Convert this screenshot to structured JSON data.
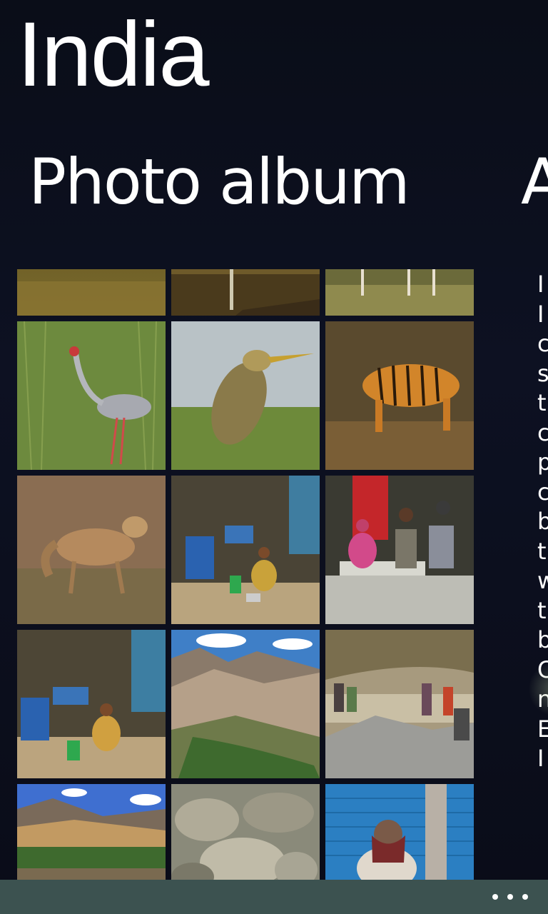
{
  "app": {
    "title": "India"
  },
  "pivot": {
    "current": "Photo album",
    "next_peek": "A"
  },
  "photo_grid": {
    "tiles": [
      {
        "name": "photo-pond",
        "desc": "pond water"
      },
      {
        "name": "photo-heron-legs",
        "desc": "bird legs on log"
      },
      {
        "name": "photo-deer-legs",
        "desc": "deer legs in grass"
      },
      {
        "name": "photo-sarus-crane",
        "desc": "sarus crane"
      },
      {
        "name": "photo-pond-heron",
        "desc": "pond heron"
      },
      {
        "name": "photo-tiger",
        "desc": "tiger"
      },
      {
        "name": "photo-jackal",
        "desc": "jackal"
      },
      {
        "name": "photo-street-family",
        "desc": "family in doorway"
      },
      {
        "name": "photo-people-steps",
        "desc": "people on steps"
      },
      {
        "name": "photo-street-family-2",
        "desc": "family near blue shutter"
      },
      {
        "name": "photo-mountains",
        "desc": "mountain valley"
      },
      {
        "name": "photo-workers-gravel",
        "desc": "workers at gravel pile"
      },
      {
        "name": "photo-valley-town",
        "desc": "valley town"
      },
      {
        "name": "photo-rocks",
        "desc": "rocky ground"
      },
      {
        "name": "photo-man-shutter",
        "desc": "man before blue shutter"
      }
    ]
  },
  "side_panel": {
    "letters": [
      "I",
      "I",
      "c",
      "s",
      "t",
      "c",
      "p",
      "c",
      "b",
      "t",
      "w",
      "t",
      "b",
      "C",
      "n",
      "E",
      "I"
    ]
  },
  "app_bar": {
    "more_label": "more options"
  }
}
